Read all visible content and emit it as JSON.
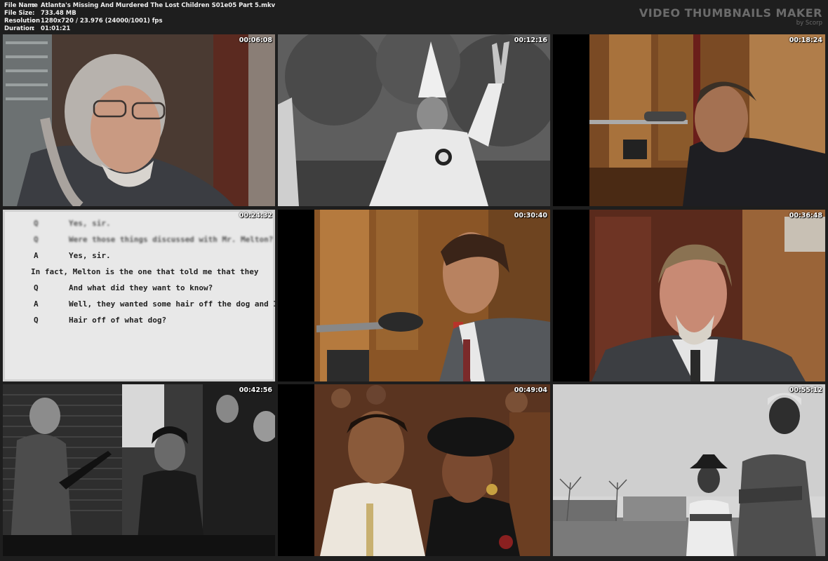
{
  "file_info": {
    "name_label": "File Name",
    "name_value": "Atlanta's Missing And Murdered The Lost Children S01e05 Part 5.mkv",
    "size_label": "File Size",
    "size_value": "733.48 MB",
    "res_label": "Resolution",
    "res_value": "1280x720 / 23.976 (24000/1001) fps",
    "dur_label": "Duration",
    "dur_value": "01:01:21",
    "separator": ":"
  },
  "brand": {
    "title": "VIDEO THUMBNAILS MAKER",
    "subtitle": "by Scorp"
  },
  "thumbnails": [
    {
      "time": "00:06:08"
    },
    {
      "time": "00:12:16"
    },
    {
      "time": "00:18:24"
    },
    {
      "time": "00:24:32"
    },
    {
      "time": "00:30:40"
    },
    {
      "time": "00:36:48"
    },
    {
      "time": "00:42:56"
    },
    {
      "time": "00:49:04"
    },
    {
      "time": "00:55:12"
    }
  ],
  "transcript": {
    "l1_mark": "Q",
    "l1_text": "Yes, sir.",
    "l2_mark": "Q",
    "l2_text": "Were those things discussed with Mr. Melton?",
    "l3_mark": "A",
    "l3_text": "Yes, sir.",
    "l4_text": "In fact, Melton is the one that told me that they",
    "l5_mark": "Q",
    "l5_text": "And what did they want to know?",
    "l6_mark": "A",
    "l6_text": "Well, they wanted some hair off the dog and I",
    "l7_mark": "Q",
    "l7_text": "Hair off of what dog?"
  }
}
